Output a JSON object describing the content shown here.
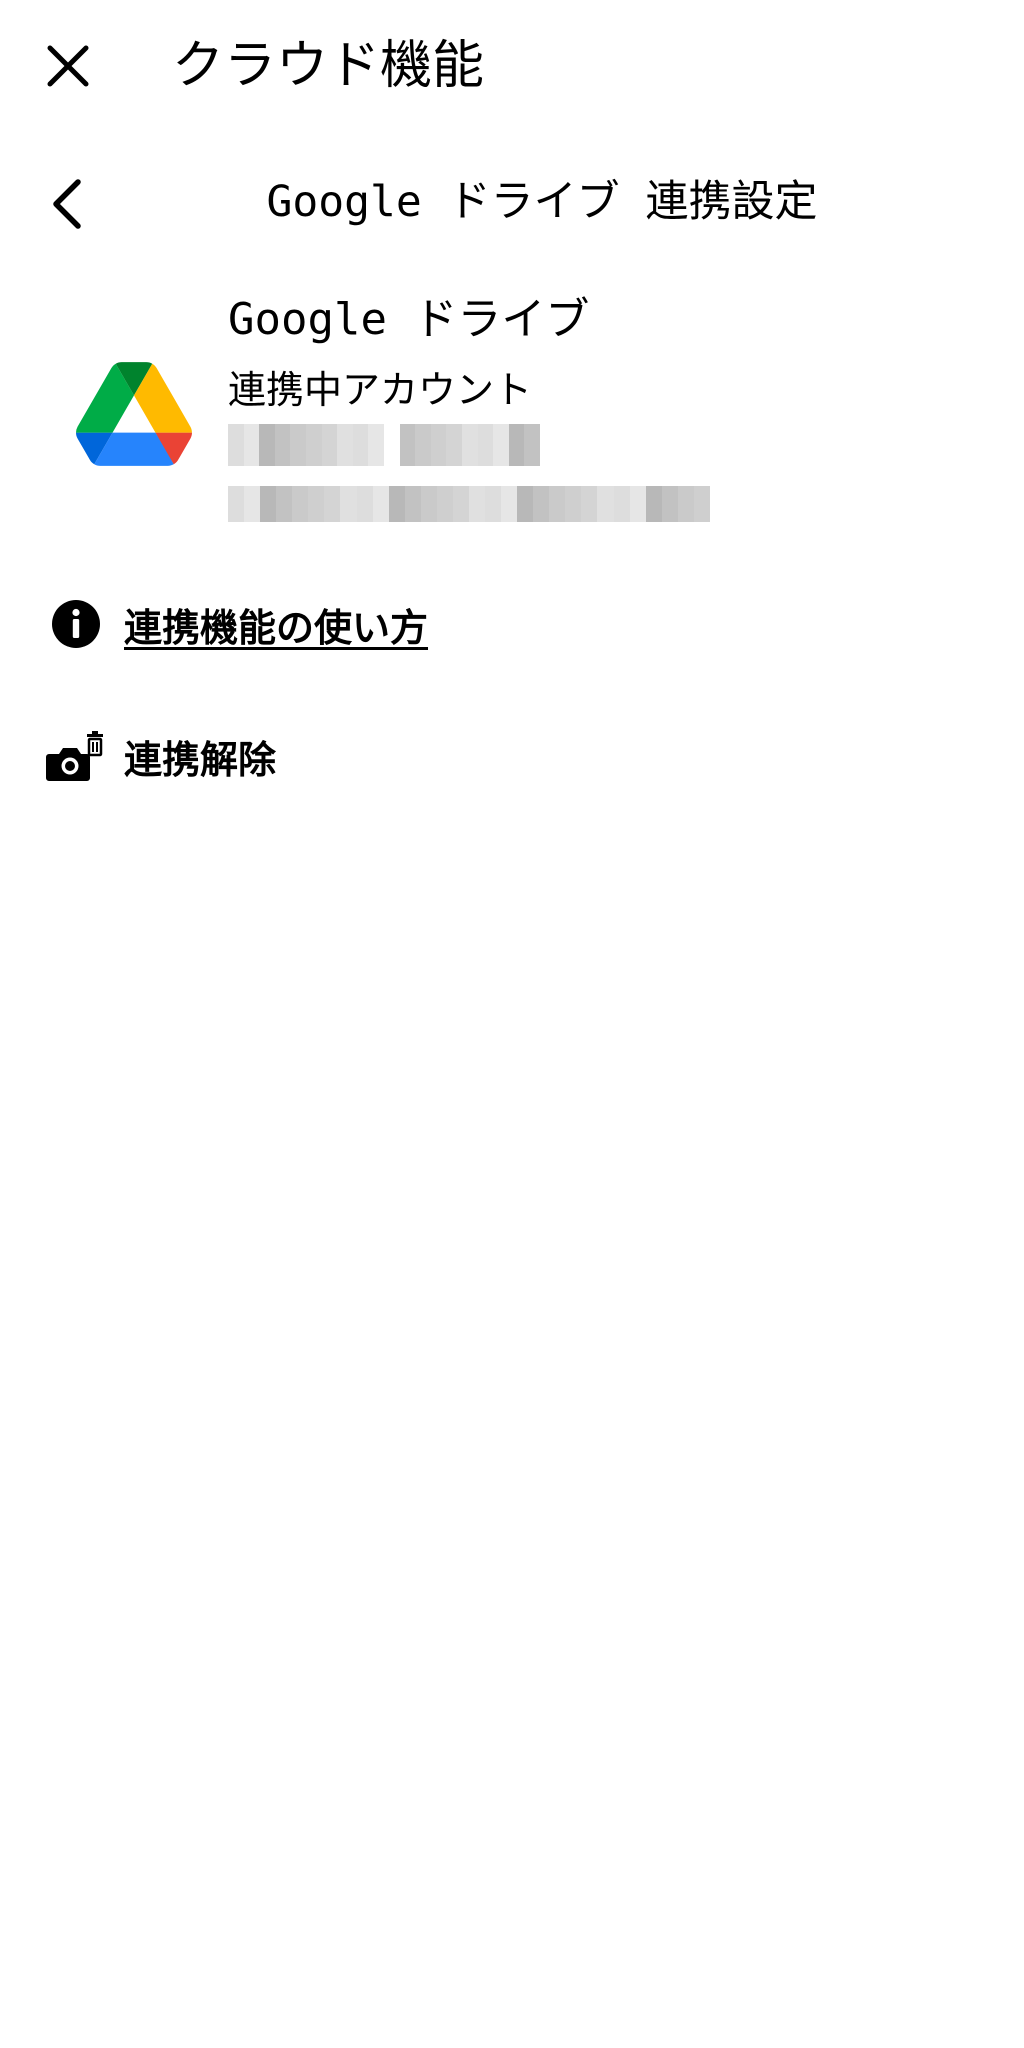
{
  "header": {
    "title": "クラウド機能",
    "close_icon": "close-icon"
  },
  "subheader": {
    "title": "Google ドライブ 連携設定",
    "back_icon": "chevron-left-icon"
  },
  "service": {
    "logo_icon": "google-drive-icon",
    "name": "Google ドライブ",
    "status": "連携中アカウント"
  },
  "menu": {
    "howto": {
      "icon": "info-icon",
      "label": "連携機能の使い方"
    },
    "unlink": {
      "icon": "camera-trash-icon",
      "label": "連携解除"
    }
  },
  "colors": {
    "drive_green": "#1e8e3e",
    "drive_yellow": "#fbbc04",
    "drive_blue": "#4285f4",
    "drive_red": "#ea4335",
    "drive_dark_green": "#188038",
    "drive_dark_blue": "#1967d2"
  }
}
